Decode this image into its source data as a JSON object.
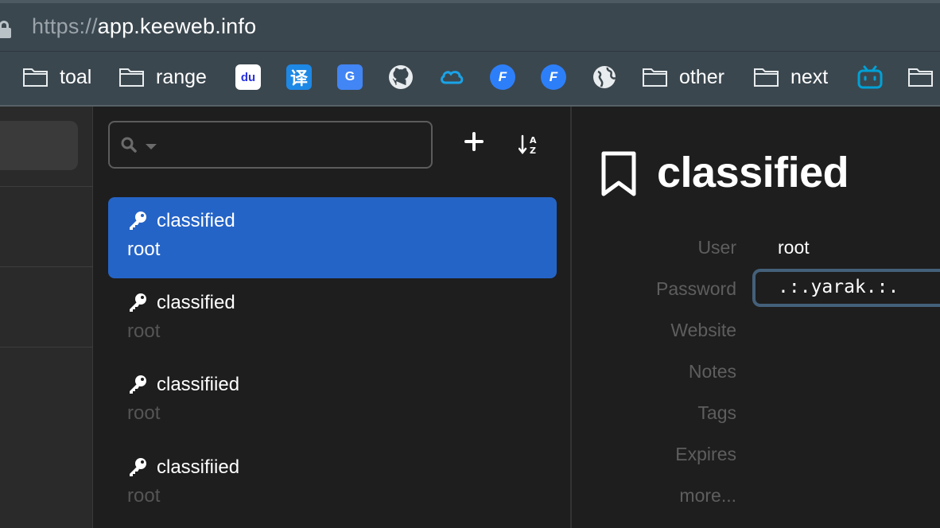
{
  "browser": {
    "url_scheme": "https://",
    "url_host": "app.keeweb.info"
  },
  "bookmarks": [
    {
      "type": "folder",
      "label": "toal"
    },
    {
      "type": "folder",
      "label": "range"
    },
    {
      "type": "favicon",
      "icon": "baidu-icon",
      "glyph": "du",
      "color": "#2932e1"
    },
    {
      "type": "favicon",
      "icon": "translate-icon",
      "glyph": "译",
      "color": "#1e88e5"
    },
    {
      "type": "favicon",
      "icon": "google-translate-icon",
      "glyph": "G",
      "color": "#4285f4"
    },
    {
      "type": "favicon",
      "icon": "github-icon",
      "glyph": "",
      "color": "#ffffff"
    },
    {
      "type": "favicon",
      "icon": "cloud-icon",
      "glyph": "",
      "color": "#1aa3e8"
    },
    {
      "type": "favicon",
      "icon": "f-logo-icon",
      "glyph": "F",
      "color": "#2d7ff9"
    },
    {
      "type": "favicon",
      "icon": "f-logo-icon",
      "glyph": "F",
      "color": "#2d7ff9"
    },
    {
      "type": "favicon",
      "icon": "globe-icon",
      "glyph": "",
      "color": "#ffffff"
    },
    {
      "type": "folder",
      "label": "other"
    },
    {
      "type": "folder",
      "label": "next"
    },
    {
      "type": "favicon",
      "icon": "bilibili-icon",
      "glyph": "",
      "color": "#00a1d6"
    },
    {
      "type": "folder",
      "label": ""
    }
  ],
  "entries": [
    {
      "title": "classified",
      "user": "root",
      "active": true
    },
    {
      "title": "classified",
      "user": "root",
      "active": false
    },
    {
      "title": "classifiied",
      "user": "root",
      "active": false
    },
    {
      "title": "classifiied",
      "user": "root",
      "active": false
    }
  ],
  "detail": {
    "title": "classified",
    "labels": {
      "user": "User",
      "password": "Password",
      "website": "Website",
      "notes": "Notes",
      "tags": "Tags",
      "expires": "Expires",
      "more": "more..."
    },
    "user_value": "root",
    "password_value": ".:.yarak.:."
  },
  "colors": {
    "accent": "#2564c7",
    "password_focus": "#44607a"
  }
}
